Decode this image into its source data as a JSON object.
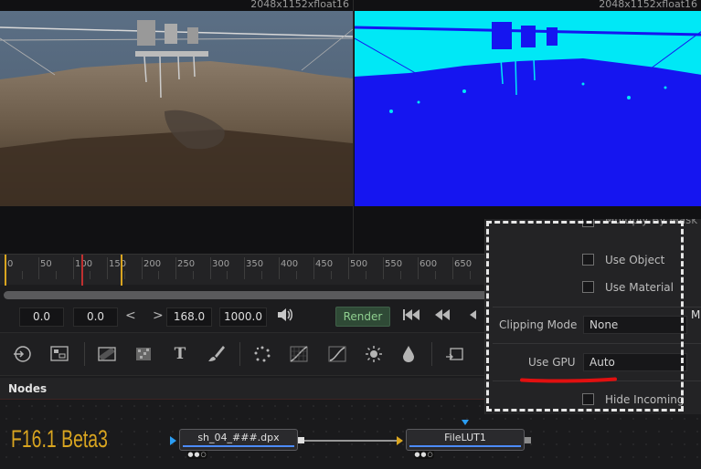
{
  "viewers": {
    "left": {
      "resolution": "2048x1152xfloat16"
    },
    "right": {
      "resolution": "2048x1152xfloat16"
    }
  },
  "ruler": {
    "ticks": [
      "0",
      "50",
      "100",
      "150",
      "200",
      "250",
      "300",
      "350",
      "400",
      "450",
      "500",
      "550",
      "600",
      "650"
    ]
  },
  "transport": {
    "global_start": "0.0",
    "render_start": "0.0",
    "prev_glyph": "<",
    "next_glyph": ">",
    "current_time": "168.0",
    "global_end": "1000.0",
    "render_label": "Render",
    "colors": {
      "render_text": "#8fcf8f",
      "render_bg": "#2f4a36"
    }
  },
  "toolbar": {
    "icons": [
      "merge-icon",
      "loader-icon",
      "background-icon",
      "fast-noise-icon",
      "text-icon",
      "paint-icon",
      "particles-icon",
      "color-curves-icon",
      "brightness-contrast-icon",
      "blur-icon",
      "color-corrector-icon",
      "transform-icon"
    ],
    "text_tool_glyph": "T"
  },
  "nodes": {
    "panel_title": "Nodes",
    "watermark": "F16.1 Beta3",
    "items": [
      {
        "name": "sh_04_###.dpx",
        "dots": "●●○"
      },
      {
        "name": "FileLUT1",
        "dots": "●●○"
      }
    ],
    "colors": {
      "watermark": "#d9a520",
      "node_bar": "#4c8cff"
    }
  },
  "inspector": {
    "multiply_by_mask": "Multiply By Mask",
    "use_object": "Use Object",
    "use_material": "Use Material",
    "clipping_mode_label": "Clipping Mode",
    "clipping_mode_value": "None",
    "use_gpu_label": "Use GPU",
    "use_gpu_value": "Auto",
    "hide_incoming": "Hide Incoming",
    "edge_letter": "M",
    "colors": {
      "highlight_underline": "#e11010",
      "dashed_outline": "#e6e6e6"
    }
  }
}
